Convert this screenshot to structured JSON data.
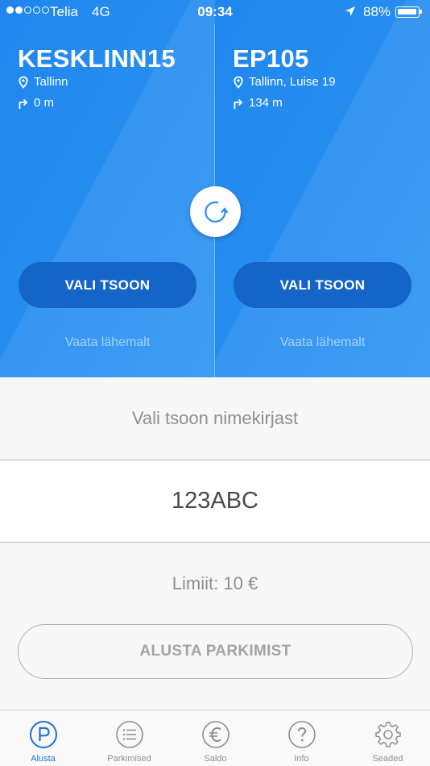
{
  "status_bar": {
    "carrier": "Telia",
    "network": "4G",
    "time": "09:34",
    "battery": "88%"
  },
  "zones": [
    {
      "code": "KESKLINN15",
      "address": "Tallinn",
      "distance": "0 m",
      "select_label": "VALI TSOON",
      "more_label": "Vaata lähemalt"
    },
    {
      "code": "EP105",
      "address": "Tallinn, Luise 19",
      "distance": "134 m",
      "select_label": "VALI TSOON",
      "more_label": "Vaata lähemalt"
    }
  ],
  "list_link": "Vali tsoon nimekirjast",
  "plate": "123ABC",
  "limit": "Limiit: 10 €",
  "start_button": "ALUSTA PARKIMIST",
  "tabs": [
    {
      "label": "Alusta",
      "icon": "parking-icon",
      "active": true
    },
    {
      "label": "Parkimised",
      "icon": "list-icon",
      "active": false
    },
    {
      "label": "Saldo",
      "icon": "euro-icon",
      "active": false
    },
    {
      "label": "Info",
      "icon": "question-icon",
      "active": false
    },
    {
      "label": "Seaded",
      "icon": "gear-icon",
      "active": false
    }
  ],
  "colors": {
    "primary_blue": "#2c8ff0",
    "button_blue": "#1565c8",
    "active_tab": "#1e6fd9",
    "inactive_text": "#8e8e8e"
  }
}
